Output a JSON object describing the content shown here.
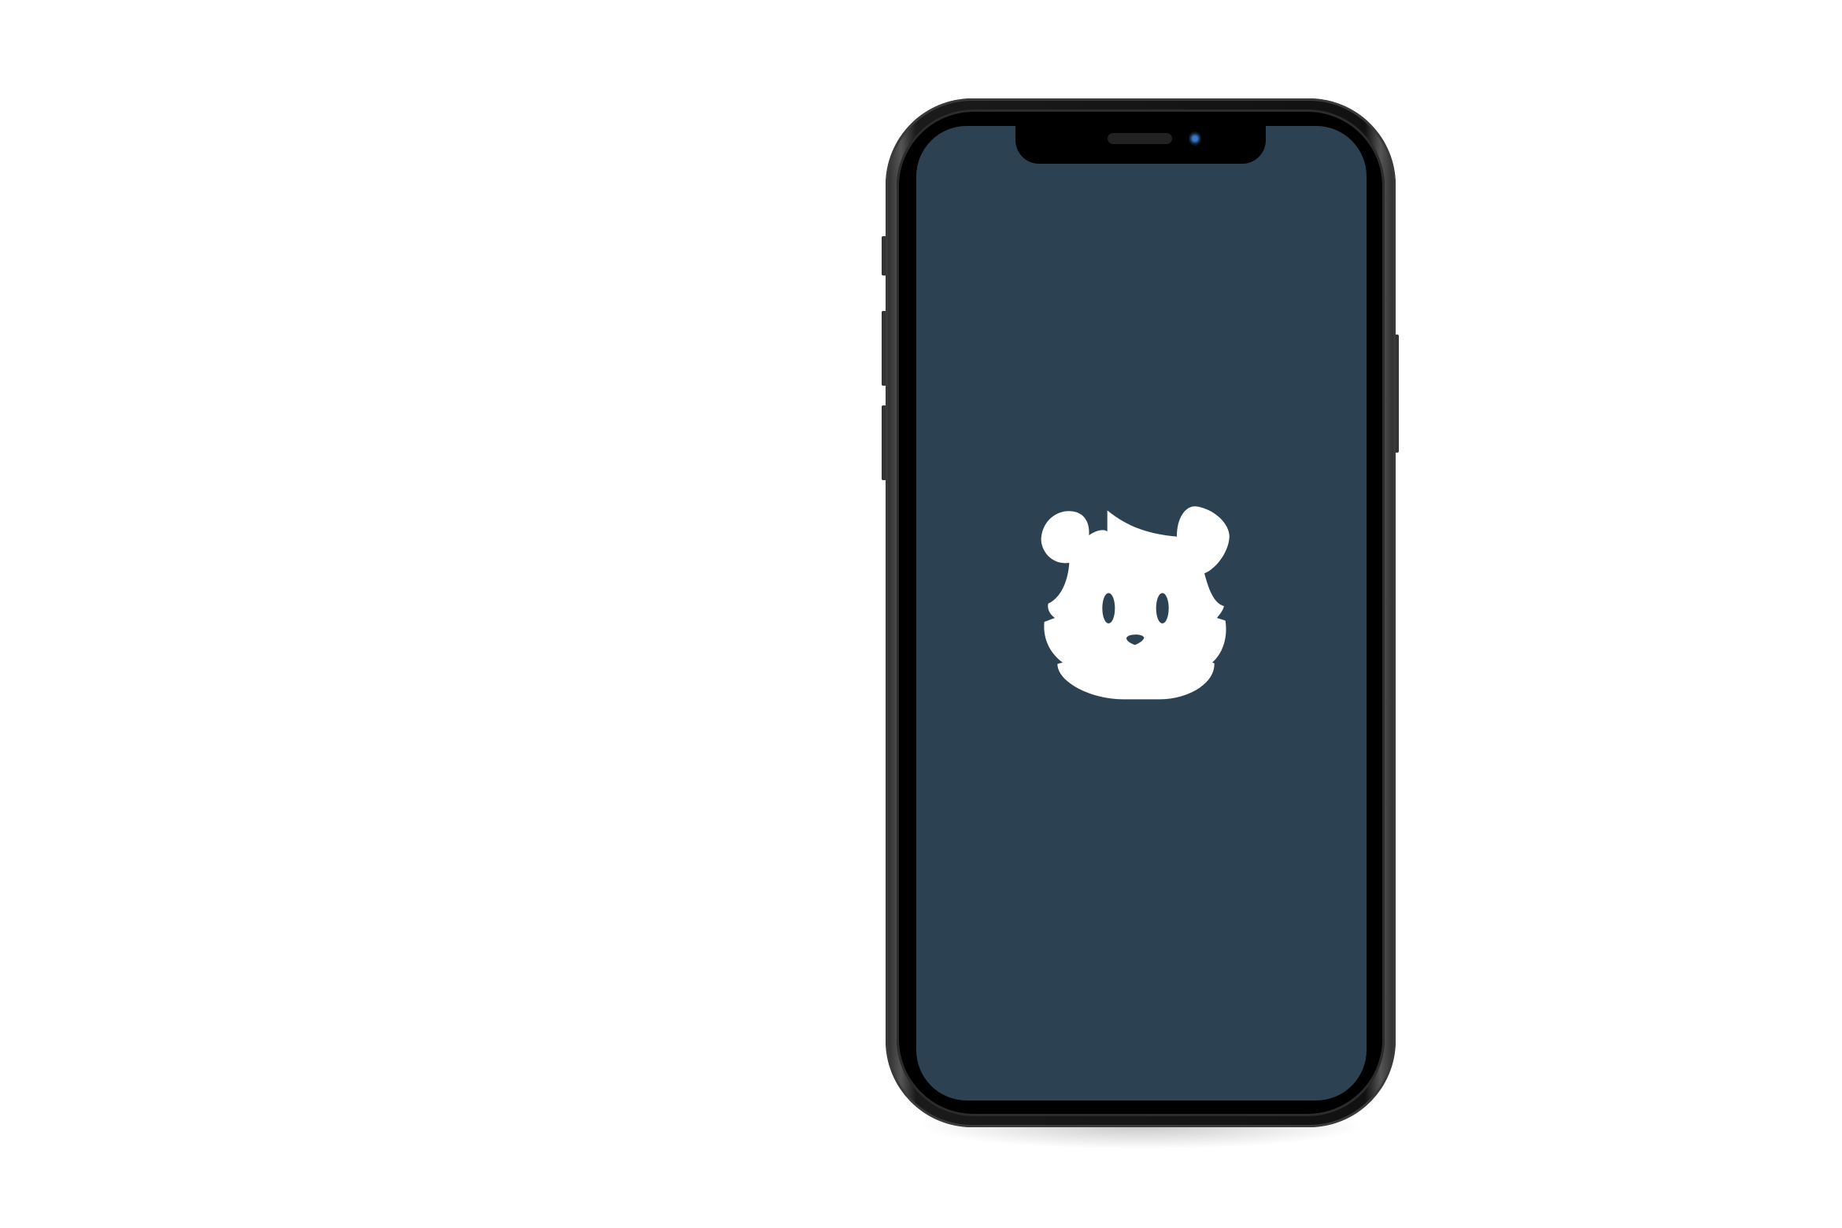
{
  "screen": {
    "background_color": "#2c4151",
    "logo_icon": "bear-face-logo",
    "logo_color": "#ffffff"
  },
  "device": {
    "frame_color": "#1a1a1a"
  }
}
